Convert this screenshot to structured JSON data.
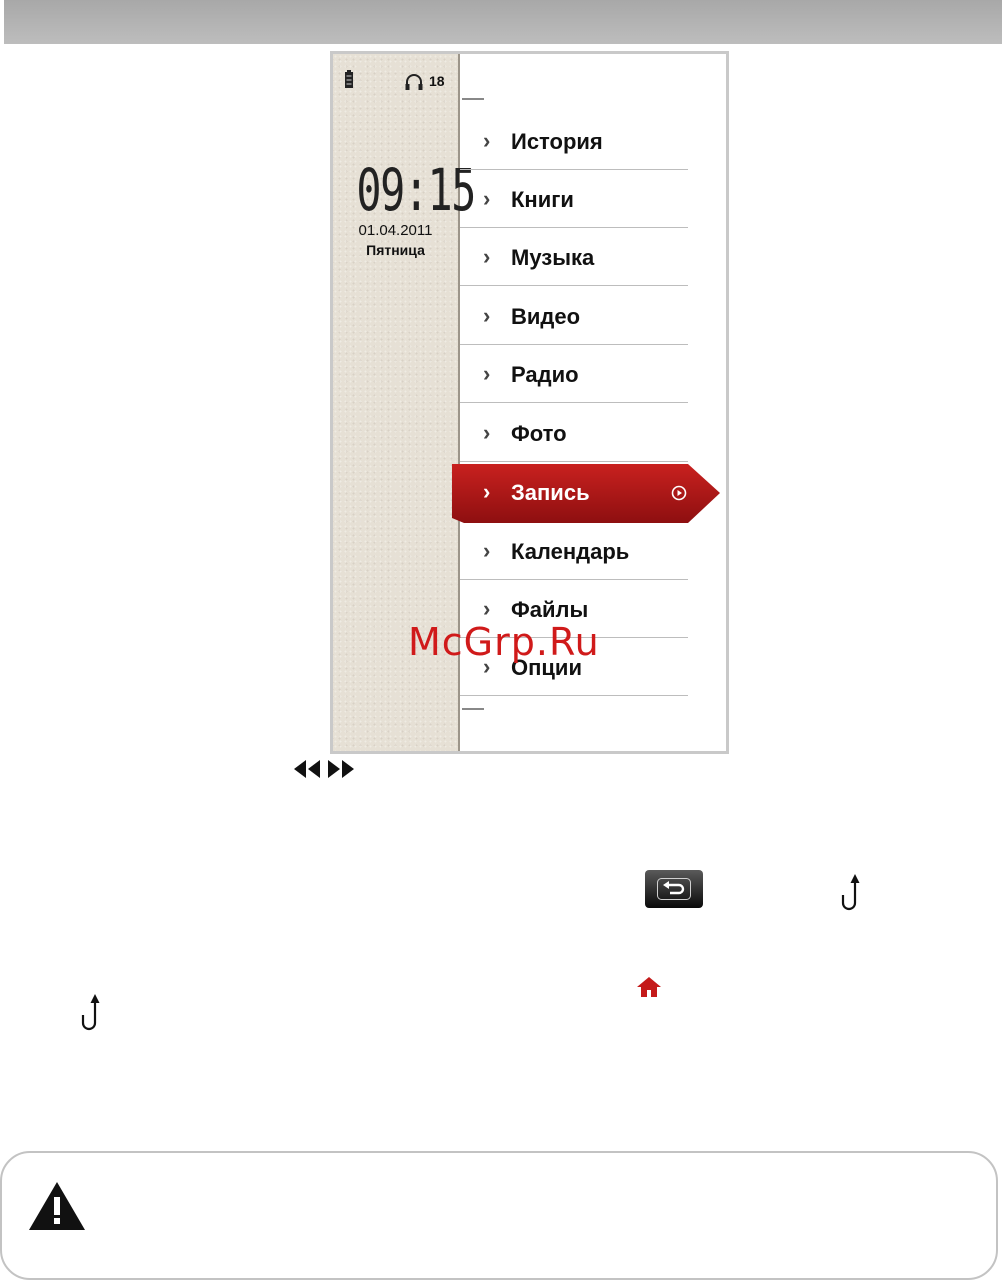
{
  "device": {
    "status": {
      "volume": "18",
      "battery_icon": "battery-icon",
      "headphone_icon": "headphone-icon"
    },
    "clock": {
      "time": "09:15",
      "date": "01.04.2011",
      "weekday": "Пятница"
    },
    "menu": [
      {
        "label": "История",
        "selected": false
      },
      {
        "label": "Книги",
        "selected": false
      },
      {
        "label": "Музыка",
        "selected": false
      },
      {
        "label": "Видео",
        "selected": false
      },
      {
        "label": "Радио",
        "selected": false
      },
      {
        "label": "Фото",
        "selected": false
      },
      {
        "label": "Запись",
        "selected": true
      },
      {
        "label": "Календарь",
        "selected": false
      },
      {
        "label": "Файлы",
        "selected": false
      },
      {
        "label": "Опции",
        "selected": false
      }
    ],
    "accent_color": "#b5191a"
  },
  "watermark": "McGrp.Ru",
  "icons": {
    "seek": "rewind-forward-icon",
    "back_button": "back-button-icon",
    "return": "return-arrow-icon",
    "home": "home-icon",
    "warning": "warning-icon"
  },
  "colors": {
    "home_icon": "#c41a1a",
    "watermark": "#d01a1a"
  }
}
